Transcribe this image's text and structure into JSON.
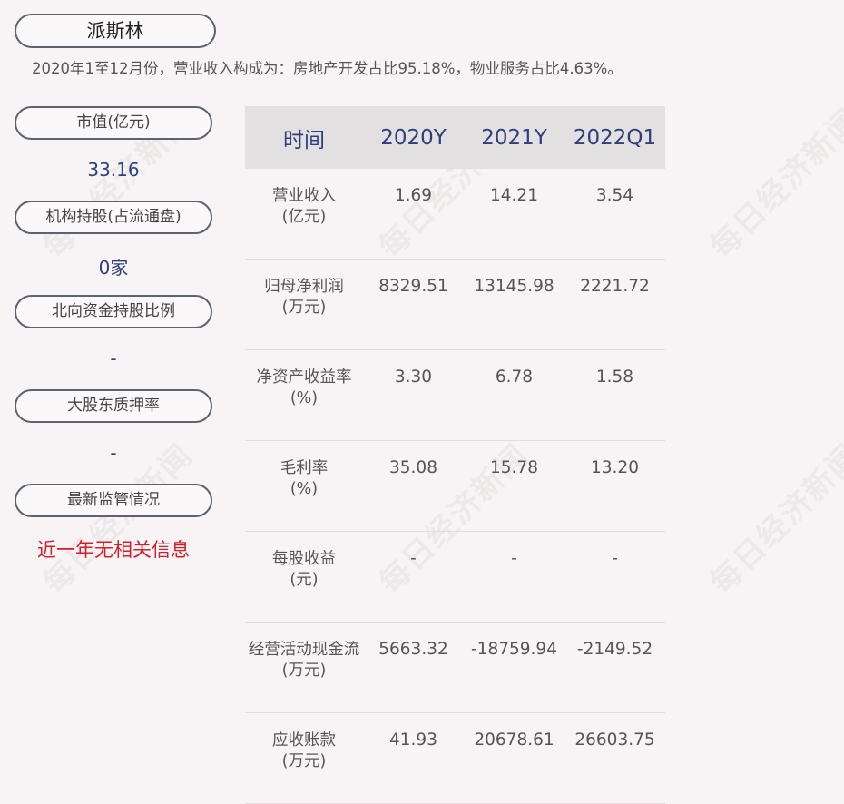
{
  "header": {
    "company_name": "派斯林",
    "revenue_note": "2020年1至12月份，营业收入构成为：房地产开发占比95.18%，物业服务占比4.63%。"
  },
  "sidebar": {
    "items": [
      {
        "label": "市值(亿元)",
        "value": "33.16",
        "value_color": "#2f3f7c"
      },
      {
        "label": "机构持股(占流通盘)",
        "value": "0家",
        "value_color": "#2f3f7c"
      },
      {
        "label": "北向资金持股比例",
        "value": "-",
        "value_color": "#2f3f7c"
      },
      {
        "label": "大股东质押率",
        "value": "-",
        "value_color": "#2f3f7c"
      },
      {
        "label": "最新监管情况",
        "value": "近一年无相关信息",
        "value_color": "#d0202b"
      }
    ]
  },
  "table": {
    "headers": [
      "时间",
      "2020Y",
      "2021Y",
      "2022Q1"
    ],
    "rows": [
      {
        "label": "营业收入",
        "unit": "(亿元)",
        "values": [
          "1.69",
          "14.21",
          "3.54"
        ]
      },
      {
        "label": "归母净利润",
        "unit": "(万元)",
        "values": [
          "8329.51",
          "13145.98",
          "2221.72"
        ]
      },
      {
        "label": "净资产收益率",
        "unit": "(%)",
        "values": [
          "3.30",
          "6.78",
          "1.58"
        ]
      },
      {
        "label": "毛利率",
        "unit": "(%)",
        "values": [
          "35.08",
          "15.78",
          "13.20"
        ]
      },
      {
        "label": "每股收益",
        "unit": "(元)",
        "values": [
          "-",
          "-",
          "-"
        ]
      },
      {
        "label": "经营活动现金流",
        "unit": "(万元)",
        "values": [
          "5663.32",
          "-18759.94",
          "-2149.52"
        ]
      },
      {
        "label": "应收账款",
        "unit": "(万元)",
        "values": [
          "41.93",
          "20678.61",
          "26603.75"
        ]
      }
    ]
  },
  "watermark": {
    "text": "每日经济新闻"
  },
  "colors": {
    "background": "#f8f4f5",
    "header_blue": "#2f3f7c",
    "alert_red": "#d0202b",
    "table_header_bg": "#e3e0e2"
  }
}
